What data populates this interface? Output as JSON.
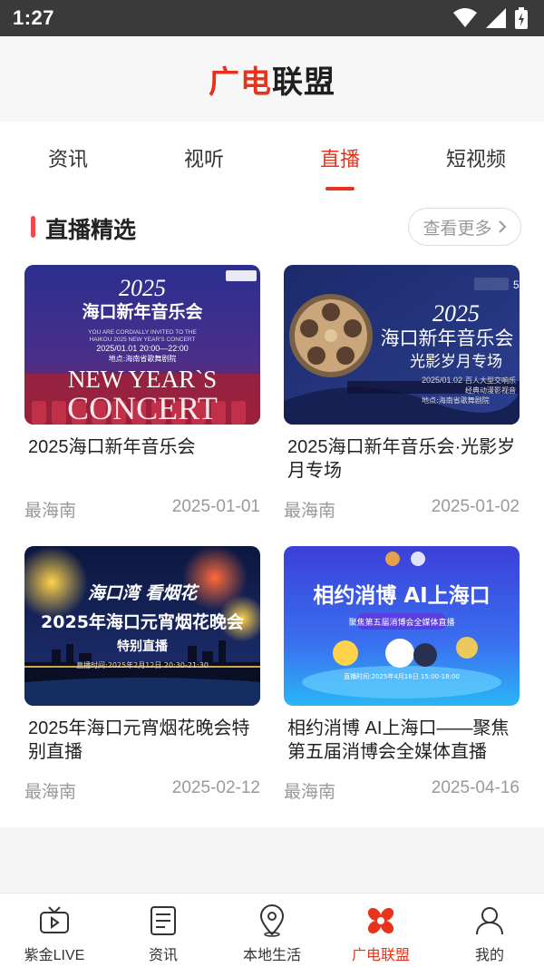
{
  "status_bar": {
    "time": "1:27"
  },
  "header": {
    "brand_part1": "广电",
    "brand_part2": "联盟"
  },
  "tabs": [
    {
      "label": "资讯",
      "active": false
    },
    {
      "label": "视听",
      "active": false
    },
    {
      "label": "直播",
      "active": true
    },
    {
      "label": "短视频",
      "active": false
    }
  ],
  "section": {
    "title": "直播精选",
    "more_label": "查看更多"
  },
  "cards": [
    {
      "title": "2025海口新年音乐会",
      "source": "最海南",
      "date": "2025-01-01",
      "thumb": {
        "line1": "2025",
        "line2": "海口新年音乐会",
        "line3": "YOU ARE CORDIALLY INVITED TO THE",
        "line4": "HAIKOU 2025 NEW YEAR'S CONCERT",
        "line5": "2025/01.01 20:00—22:00",
        "line6": "地点:海南省歌舞剧院",
        "line7": "NEW YEAR`S",
        "line8": "CONCERT"
      }
    },
    {
      "title": "2025海口新年音乐会·光影岁月专场",
      "source": "最海南",
      "date": "2025-01-02",
      "thumb": {
        "line1": "2025",
        "line2": "海口新年音乐会",
        "line3": "光影岁月专场",
        "line4": "2025/01.02",
        "line5": "百人大型交响乐",
        "line6": "经典动漫影视音",
        "line7": "地点:海南省歌舞剧院",
        "line8": "5"
      }
    },
    {
      "title": "2025年海口元宵烟花晚会特别直播",
      "source": "最海南",
      "date": "2025-02-12",
      "thumb": {
        "line1": "海口湾 看烟花",
        "line2": "2025年海口元宵烟花晚会",
        "line3": "特别直播",
        "line4": "直播时间:2025年2月12日 20:30-21:30"
      }
    },
    {
      "title": "相约消博 AI上海口——聚焦第五届消博会全媒体直播",
      "source": "最海南",
      "date": "2025-04-16",
      "thumb": {
        "line1": "相约消博 AI上海口",
        "line2": "聚焦第五届消博会全媒体直播",
        "line3": "直播时间:2025年4月16日 15:00-18:00"
      }
    }
  ],
  "bottom_nav": [
    {
      "label": "紫金LIVE",
      "icon": "tv-icon",
      "active": false
    },
    {
      "label": "资讯",
      "icon": "news-list-icon",
      "active": false
    },
    {
      "label": "本地生活",
      "icon": "location-pin-icon",
      "active": false
    },
    {
      "label": "广电联盟",
      "icon": "alliance-logo-icon",
      "active": true
    },
    {
      "label": "我的",
      "icon": "user-icon",
      "active": false
    }
  ],
  "colors": {
    "accent": "#e8331c",
    "section_bar": "#f0494f",
    "muted": "#999999"
  }
}
